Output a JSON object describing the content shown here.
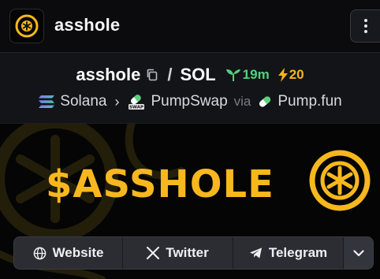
{
  "header": {
    "title": "asshole",
    "logo_icon": "asshole-logo-icon",
    "menu_icon": "more-vertical-icon"
  },
  "pair": {
    "base": "asshole",
    "separator": "/",
    "quote": "SOL",
    "age": "19m",
    "boosts": "20",
    "age_color": "#4fd17e",
    "boost_color": "#f7b31c"
  },
  "chain": {
    "chain_name": "Solana",
    "dex_name": "PumpSwap",
    "via_label": "via",
    "launchpad_name": "Pump.fun"
  },
  "banner": {
    "text": "$ASSHOLE",
    "accent": "#f7b81e"
  },
  "links": {
    "website": "Website",
    "twitter": "Twitter",
    "telegram": "Telegram"
  }
}
